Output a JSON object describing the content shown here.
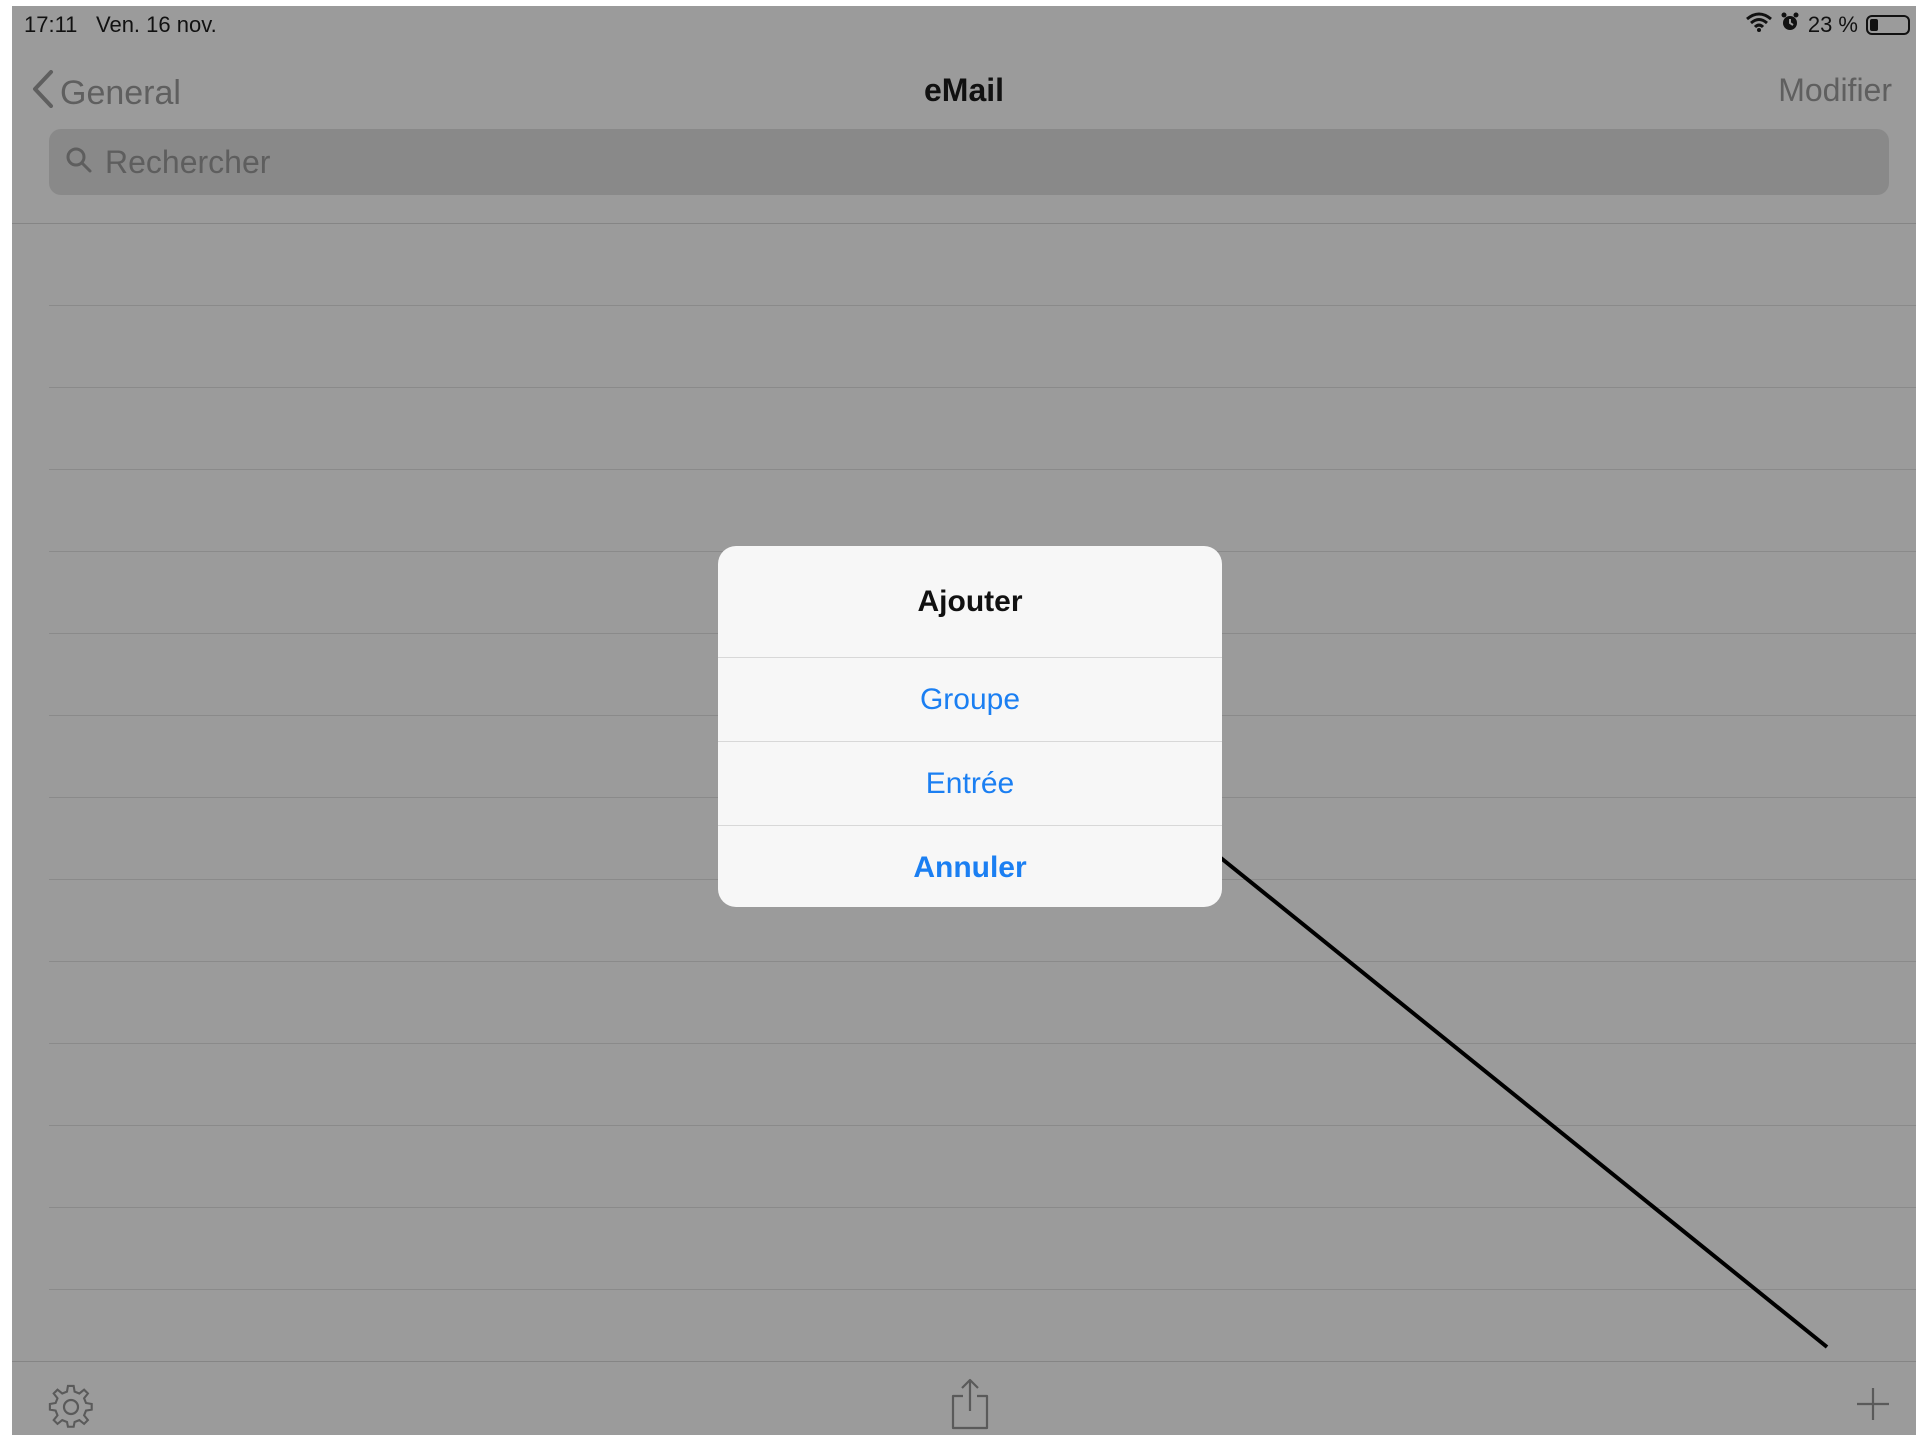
{
  "status_bar": {
    "time": "17:11",
    "date": "Ven. 16 nov.",
    "battery_text": "23 %",
    "battery_level": 0.23
  },
  "nav": {
    "back_label": "General",
    "title": "eMail",
    "edit_label": "Modifier"
  },
  "search": {
    "placeholder": "Rechercher",
    "value": ""
  },
  "list": {
    "rows": [
      "",
      "",
      "",
      "",
      "",
      "",
      "",
      "",
      "",
      "",
      "",
      "",
      ""
    ]
  },
  "dialog": {
    "title": "Ajouter",
    "buttons": [
      "Groupe",
      "Entrée",
      "Annuler"
    ]
  },
  "colors": {
    "accent": "#1b7ff2",
    "dim_background": "#9b9b9b",
    "dialog_background": "#f7f7f7"
  },
  "icons": {
    "back": "chevron-left-icon",
    "search": "magnifier-icon",
    "wifi": "wifi-icon",
    "alarm": "alarm-icon",
    "battery": "battery-icon",
    "settings": "gear-icon",
    "share": "share-icon",
    "add": "plus-icon"
  }
}
